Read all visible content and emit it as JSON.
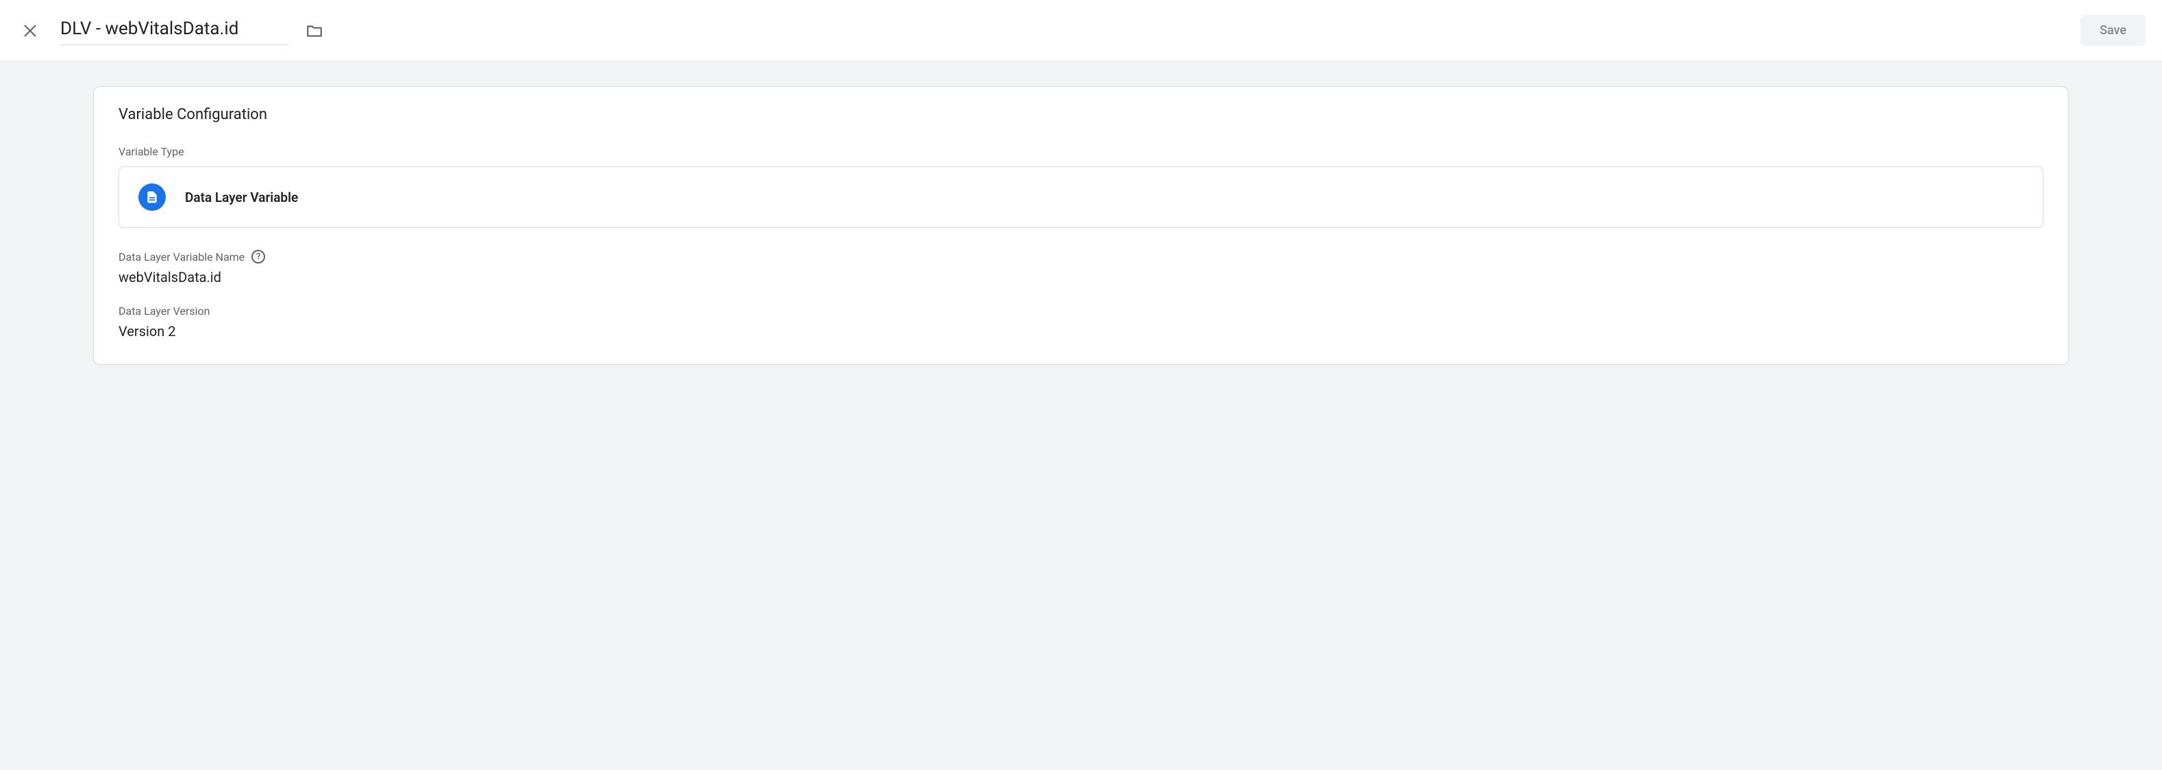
{
  "header": {
    "title": "DLV - webVitalsData.id",
    "save_label": "Save"
  },
  "card": {
    "title": "Variable Configuration",
    "variable_type_label": "Variable Type",
    "variable_type_value": "Data Layer Variable",
    "dlv_name_label": "Data Layer Variable Name",
    "dlv_name_value": "webVitalsData.id",
    "dlv_version_label": "Data Layer Version",
    "dlv_version_value": "Version 2"
  }
}
